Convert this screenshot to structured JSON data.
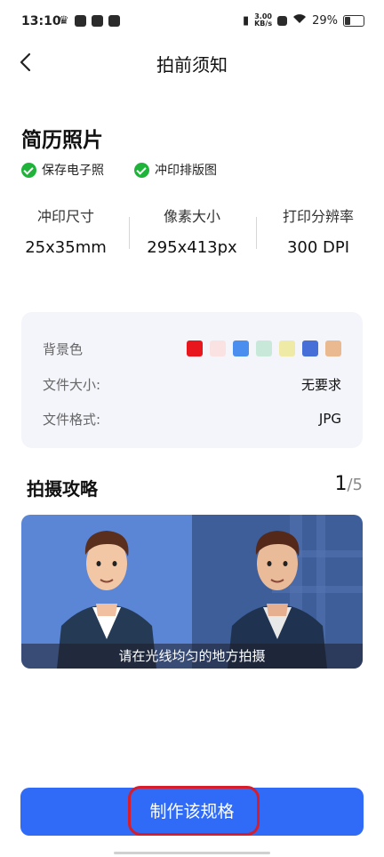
{
  "status_bar": {
    "time": "13:10",
    "speed_value": "3.00",
    "speed_unit": "KB/s",
    "battery": "29%"
  },
  "header": {
    "title": "拍前须知"
  },
  "photo": {
    "title": "简历照片",
    "features": [
      "保存电子照",
      "冲印排版图"
    ],
    "specs": [
      {
        "label": "冲印尺寸",
        "value": "25x35mm"
      },
      {
        "label": "像素大小",
        "value": "295x413px"
      },
      {
        "label": "打印分辨率",
        "value": "300 DPI"
      }
    ]
  },
  "info": {
    "bg_label": "背景色",
    "bg_colors": [
      "#e8171e",
      "#fbe2e2",
      "#4a8ff0",
      "#c8e9da",
      "#efeaa6",
      "#4670d8",
      "#ebb990"
    ],
    "size_label": "文件大小:",
    "size_value": "无要求",
    "format_label": "文件格式:",
    "format_value": "JPG"
  },
  "guide": {
    "title": "拍摄攻略",
    "current": "1",
    "total": "/5",
    "caption": "请在光线均匀的地方拍摄"
  },
  "cta": {
    "label": "制作该规格"
  }
}
